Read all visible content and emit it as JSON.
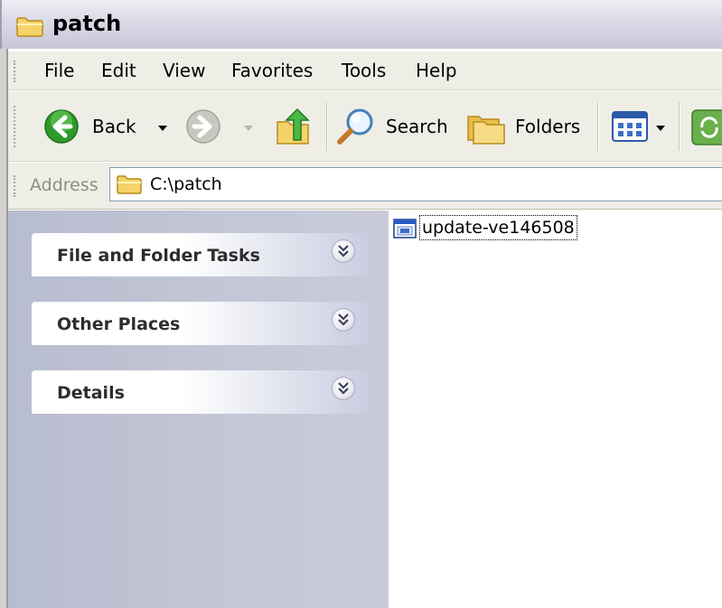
{
  "window": {
    "title": "patch"
  },
  "menu": [
    "File",
    "Edit",
    "View",
    "Favorites",
    "Tools",
    "Help"
  ],
  "toolbar": {
    "back_label": "Back",
    "search_label": "Search",
    "folders_label": "Folders"
  },
  "address": {
    "label": "Address",
    "path": "C:\\patch"
  },
  "taskpane": {
    "sections": [
      {
        "title": "File and Folder Tasks"
      },
      {
        "title": "Other Places"
      },
      {
        "title": "Details"
      }
    ]
  },
  "files": [
    {
      "name": "update-ve146508",
      "icon": "application-icon"
    }
  ],
  "colors": {
    "folder_yellow": "#f5d36a",
    "back_green": "#2f9a2c",
    "taskpane_bg": "#c3c7d6",
    "address_border": "#7f9db9"
  }
}
